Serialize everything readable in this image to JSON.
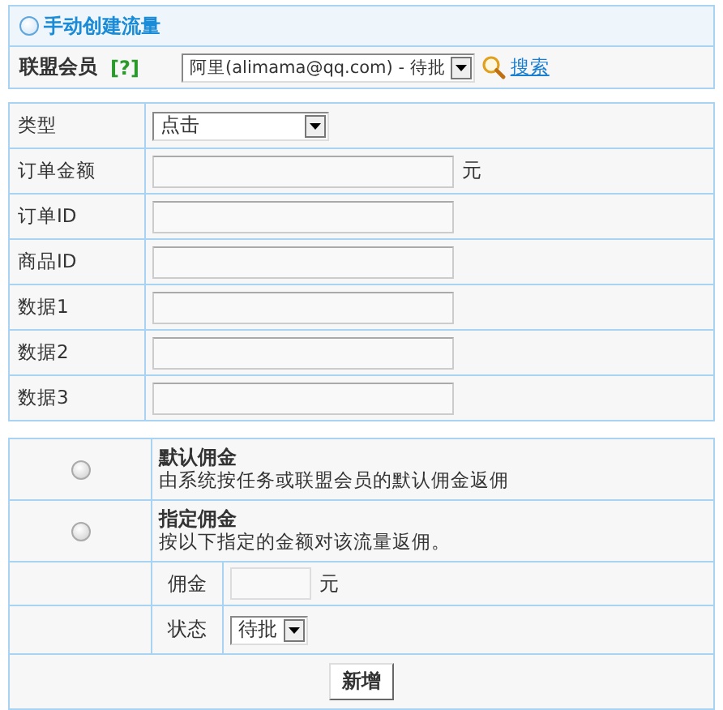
{
  "panel": {
    "title": "手动创建流量",
    "member": {
      "label": "联盟会员",
      "help": "[?]",
      "value": "阿里(alimama@qq.com) - 待批",
      "search": "搜索"
    }
  },
  "fields": [
    {
      "kind": "select",
      "label": "类型",
      "value": "点击"
    },
    {
      "kind": "input",
      "label": "订单金额",
      "unit": "元"
    },
    {
      "kind": "input",
      "label": "订单ID"
    },
    {
      "kind": "input",
      "label": "商品ID"
    },
    {
      "kind": "input",
      "label": "数据1"
    },
    {
      "kind": "input",
      "label": "数据2"
    },
    {
      "kind": "input",
      "label": "数据3"
    }
  ],
  "commission": {
    "options": [
      {
        "title": "默认佣金",
        "description": "由系统按任务或联盟会员的默认佣金返佣",
        "selected": false
      },
      {
        "title": "指定佣金",
        "description": "按以下指定的金额对该流量返佣。",
        "selected": false
      }
    ],
    "amount": {
      "label": "佣金",
      "unit": "元"
    },
    "status": {
      "label": "状态",
      "value": "待批"
    },
    "submit": "新增"
  }
}
